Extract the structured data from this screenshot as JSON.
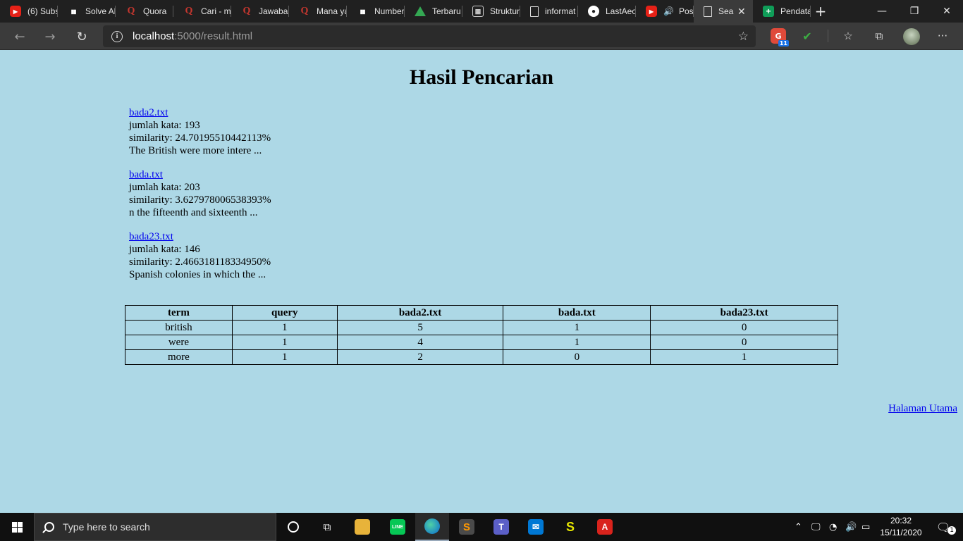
{
  "browser": {
    "tabs": [
      {
        "favicon": "youtube-icon",
        "label": "(6) Subs"
      },
      {
        "favicon": "notebook-icon",
        "label": "Solve Al"
      },
      {
        "favicon": "quora-icon",
        "label": "Quora"
      },
      {
        "favicon": "quora-icon",
        "label": "Cari - m"
      },
      {
        "favicon": "quora-icon",
        "label": "Jawaban"
      },
      {
        "favicon": "quora-icon",
        "label": "Mana ya"
      },
      {
        "favicon": "notebook-icon",
        "label": "Number"
      },
      {
        "favicon": "drive-icon",
        "label": "Terbaru"
      },
      {
        "favicon": "structure-icon",
        "label": "Struktur"
      },
      {
        "favicon": "document-icon",
        "label": "informat"
      },
      {
        "favicon": "github-icon",
        "label": "LastAeo"
      },
      {
        "favicon": "youtube-icon",
        "label": "Pos"
      },
      {
        "favicon": "document-icon",
        "label": "Sea"
      },
      {
        "favicon": "sheets-icon",
        "label": "Pendata"
      }
    ],
    "url_host": "localhost",
    "url_rest": ":5000/result.html",
    "extension_badge": "11"
  },
  "page": {
    "title": "Hasil Pencarian",
    "results": [
      {
        "file": "bada2.txt",
        "word_count": "jumlah kata: 193",
        "similarity": "similarity: 24.70195510442113%",
        "snippet": "The British were more intere ..."
      },
      {
        "file": "bada.txt",
        "word_count": "jumlah kata: 203",
        "similarity": "similarity: 3.627978006538393%",
        "snippet": "n the fifteenth and sixteenth ..."
      },
      {
        "file": "bada23.txt",
        "word_count": "jumlah kata: 146",
        "similarity": "similarity: 2.466318118334950%",
        "snippet": "Spanish colonies in which the ..."
      }
    ],
    "table": {
      "headers": [
        "term",
        "query",
        "bada2.txt",
        "bada.txt",
        "bada23.txt"
      ],
      "rows": [
        [
          "british",
          "1",
          "5",
          "1",
          "0"
        ],
        [
          "were",
          "1",
          "4",
          "1",
          "0"
        ],
        [
          "more",
          "1",
          "2",
          "0",
          "1"
        ]
      ]
    },
    "home_link": "Halaman Utama"
  },
  "taskbar": {
    "search_placeholder": "Type here to search",
    "time": "20:32",
    "date": "15/11/2020",
    "notification_count": "1"
  }
}
